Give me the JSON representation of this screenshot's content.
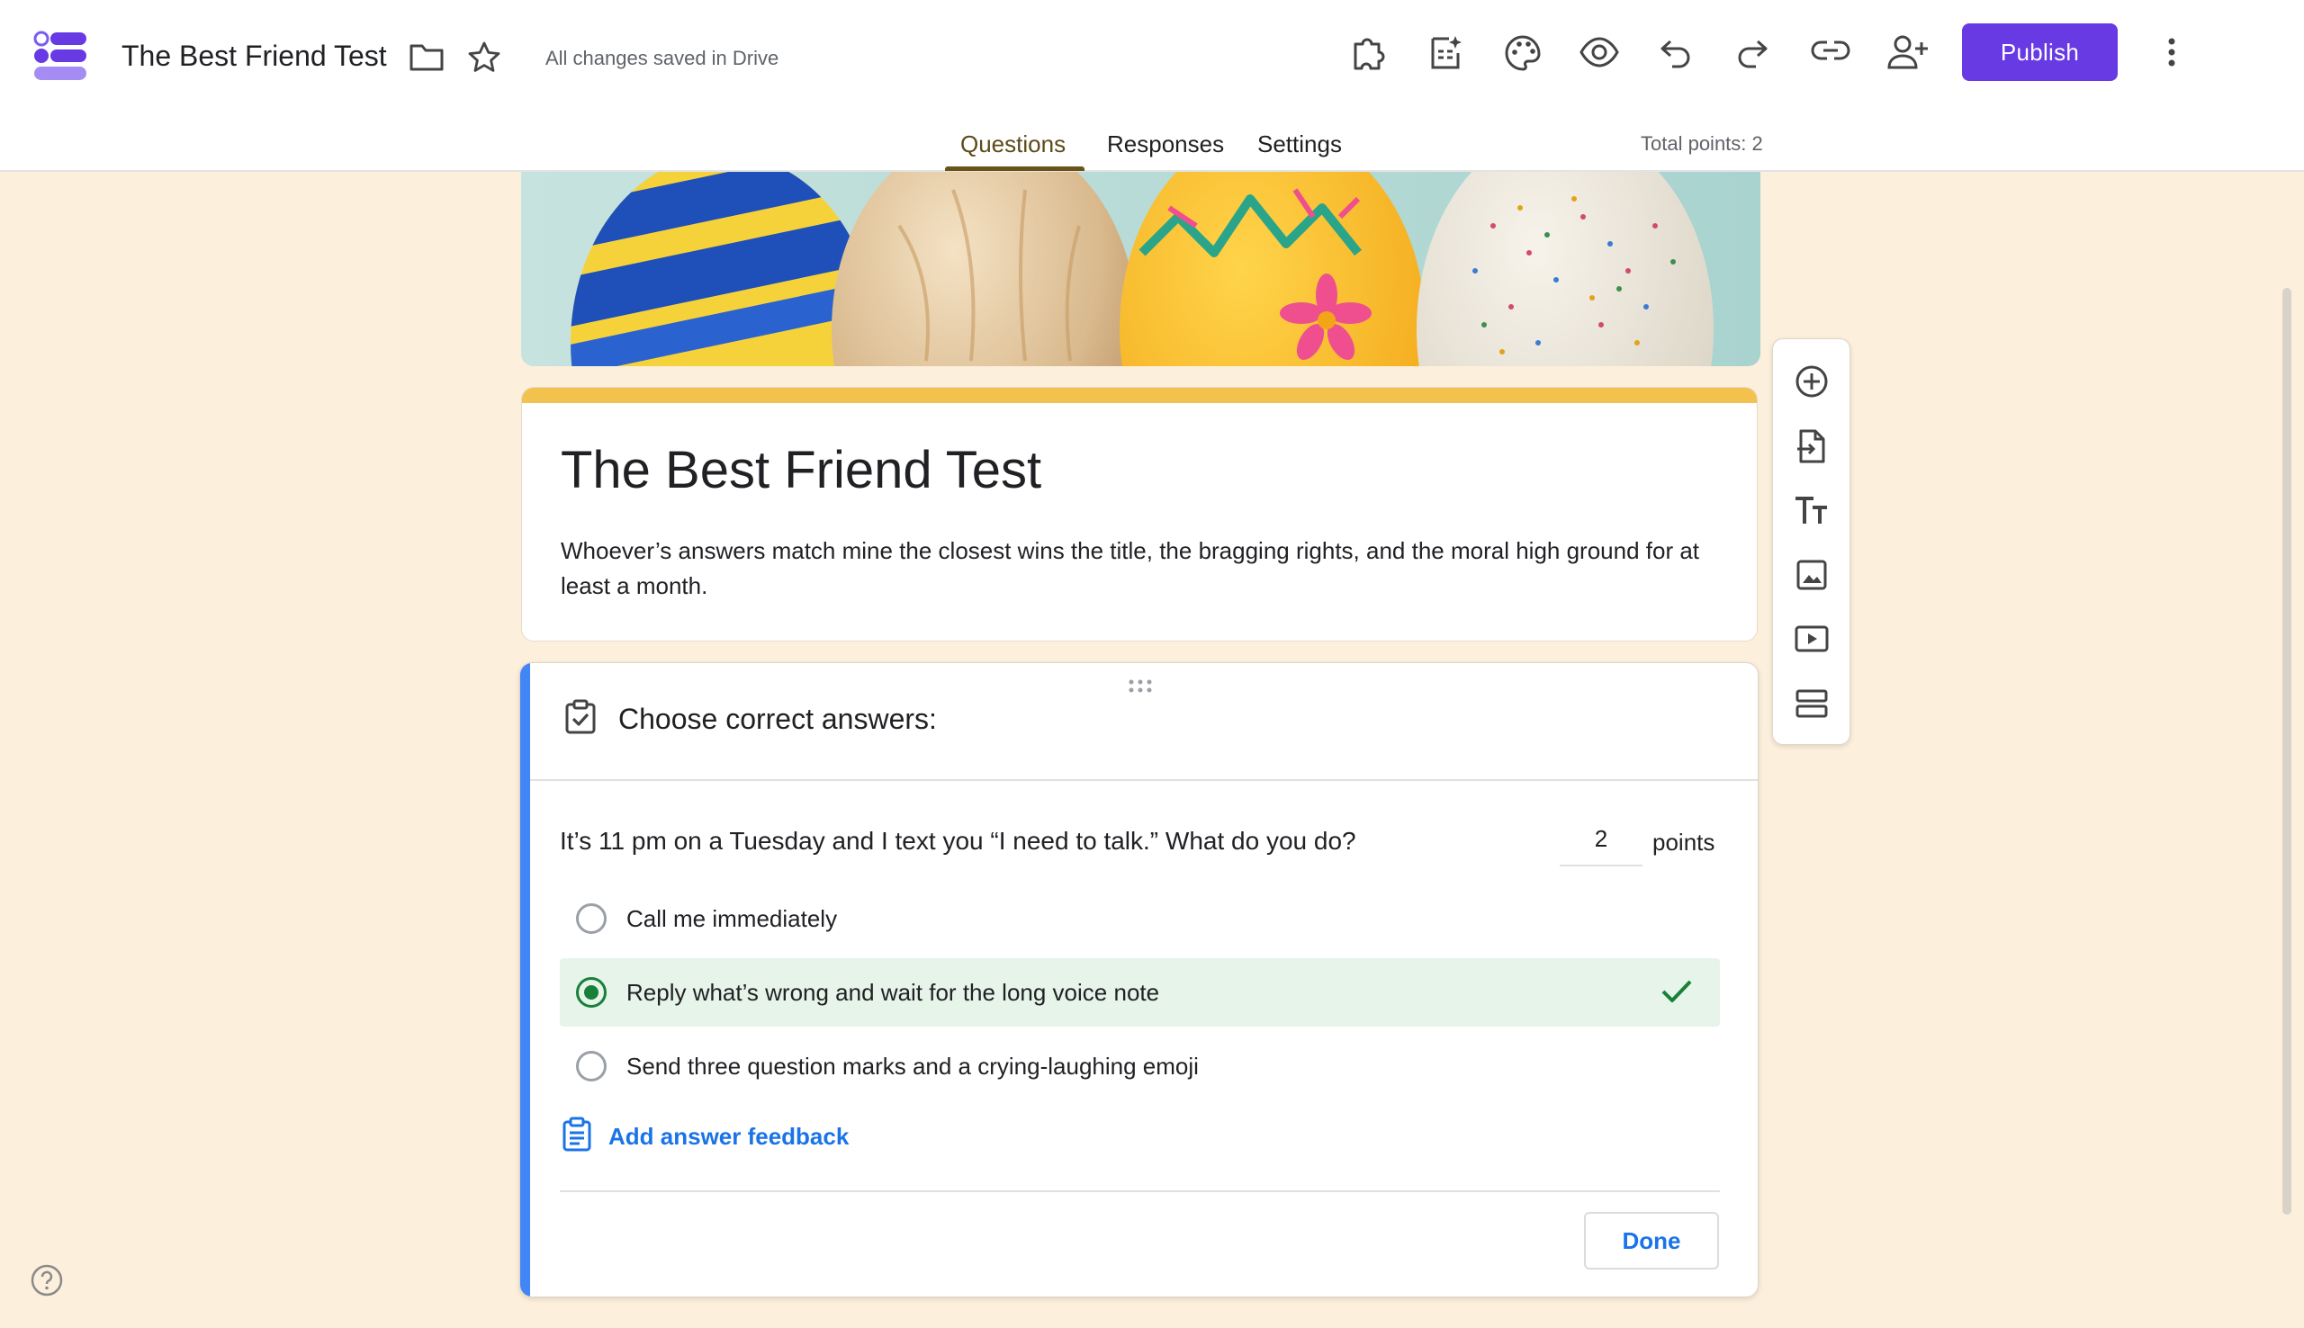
{
  "header": {
    "doc_title": "The Best Friend Test",
    "save_status": "All changes saved in Drive",
    "publish_label": "Publish",
    "tabs": [
      {
        "label": "Questions",
        "active": true
      },
      {
        "label": "Responses",
        "active": false
      },
      {
        "label": "Settings",
        "active": false
      }
    ],
    "total_points": "Total points: 2",
    "icons": [
      "folder-icon",
      "star-icon",
      "addons-icon",
      "ai-suggest-icon",
      "palette-icon",
      "preview-icon",
      "undo-icon",
      "redo-icon",
      "link-icon",
      "add-collaborator-icon",
      "more-vert-icon"
    ]
  },
  "form": {
    "title": "The Best Friend Test",
    "description": "Whoever’s answers match mine the closest wins the title, the bragging rights, and the moral high ground for at least a month."
  },
  "answer_key": {
    "heading": "Choose correct answers:",
    "question": "It’s 11 pm on a Tuesday and I text you “I need to talk.” What do you do?",
    "points_value": "2",
    "points_label": "points",
    "options": [
      {
        "label": "Call me immediately",
        "correct": false
      },
      {
        "label": "Reply what’s wrong and wait for the long voice note",
        "correct": true
      },
      {
        "label": "Send three question marks and a crying-laughing emoji",
        "correct": false
      }
    ],
    "feedback_label": "Add answer feedback",
    "done_label": "Done"
  },
  "toolbar": {
    "items": [
      "add-question",
      "import-questions",
      "add-title-description",
      "add-image",
      "add-video",
      "add-section"
    ]
  },
  "colors": {
    "page_bg": "#fcefdc",
    "accent_purple": "#673ae4",
    "title_accent": "#f2c14e",
    "question_bar": "#4285f4",
    "correct_green": "#188038",
    "correct_bg": "#e6f4ea",
    "link_blue": "#1a73e8"
  }
}
